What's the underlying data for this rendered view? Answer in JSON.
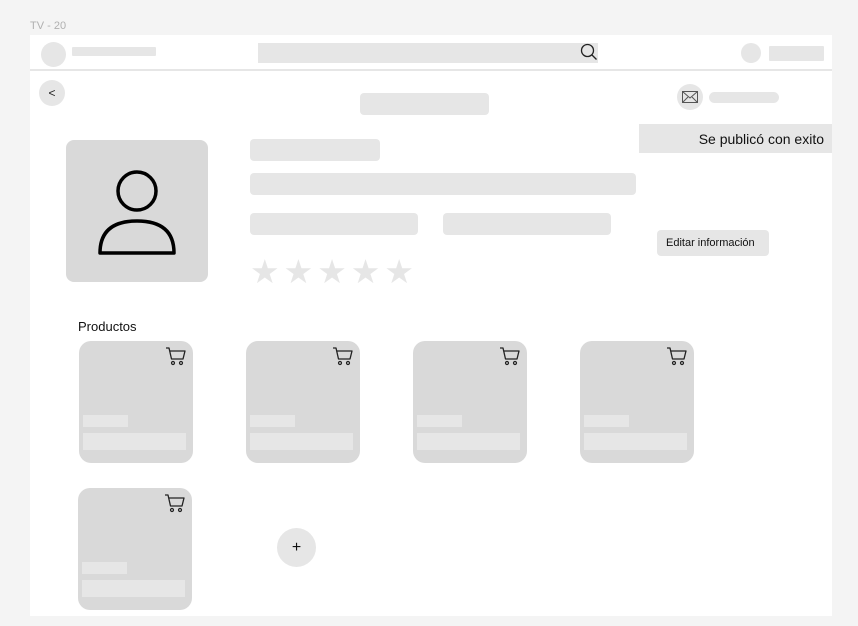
{
  "frame": {
    "title": "TV - 20"
  },
  "header": {
    "search_icon": "search-icon",
    "back_label": "<",
    "mail_icon": "mail-icon"
  },
  "toast": {
    "message": "Se publicó con exito"
  },
  "profile": {
    "avatar_icon": "user-icon",
    "rating_stars": [
      "★",
      "★",
      "★",
      "★",
      "★"
    ],
    "edit_label": "Editar información"
  },
  "products": {
    "title": "Productos",
    "card_icon": "cart-icon",
    "items_count": 5,
    "add_label": "+"
  },
  "colors": {
    "placeholder": "#e6e6e6",
    "card": "#d9d9d9",
    "background": "#f4f4f4"
  }
}
